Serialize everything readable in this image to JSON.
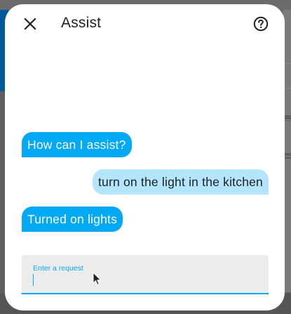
{
  "dialog": {
    "title": "Assist",
    "close_icon": "close-icon",
    "help_icon": "help-circle-icon"
  },
  "conversation": [
    {
      "speaker": "hass",
      "text": "How can I assist?"
    },
    {
      "speaker": "user",
      "text": "turn on the light in the kitchen"
    },
    {
      "speaker": "hass",
      "text": "Turned on lights"
    }
  ],
  "input": {
    "label": "Enter a request",
    "value": ""
  },
  "colors": {
    "accent": "#03a9f4",
    "user_bubble": "#b3e5fc",
    "input_bg": "#ececec"
  }
}
